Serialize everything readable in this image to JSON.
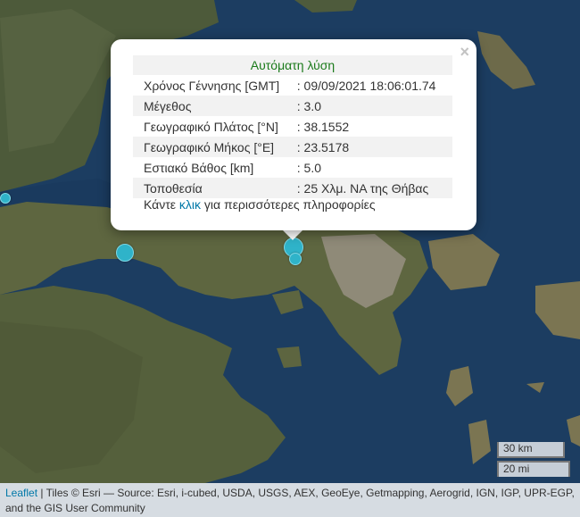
{
  "popup": {
    "title": "Αυτόματη λύση",
    "rows": [
      {
        "label": "Χρόνος Γέννησης [GMT]",
        "value": ": 09/09/2021 18:06:01.74"
      },
      {
        "label": "Μέγεθος",
        "value": ": 3.0"
      },
      {
        "label": "Γεωγραφικό Πλάτος [°N]",
        "value": ": 38.1552"
      },
      {
        "label": "Γεωγραφικό Μήκος [°E]",
        "value": ": 23.5178"
      },
      {
        "label": "Εστιακό Βάθος [km]",
        "value": ": 5.0"
      },
      {
        "label": "Τοποθεσία",
        "value": ": 25 Χλμ. ΝΑ της Θήβας"
      }
    ],
    "more_prefix": "Κάντε ",
    "more_link": "κλικ",
    "more_suffix": " για περισσότερες πληροφορίες",
    "close_symbol": "×"
  },
  "scale": {
    "km": "30 km",
    "mi": "20 mi"
  },
  "attribution": {
    "leaflet": "Leaflet",
    "text": " | Tiles © Esri — Source: Esri, i-cubed, USDA, USGS, AEX, GeoEye, Getmapping, Aerogrid, IGN, IGP, UPR-EGP, and the GIS User Community"
  },
  "colors": {
    "marker": "#2fb3c9",
    "title": "#1a7a1a",
    "link": "#0078a8",
    "sea": "#1b3a5c"
  }
}
